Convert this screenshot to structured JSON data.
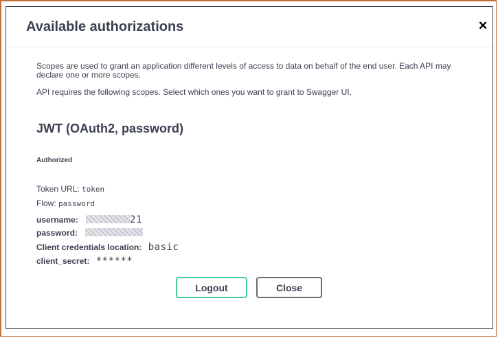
{
  "modal": {
    "title": "Available authorizations",
    "close_icon": "close-icon",
    "close_glyph": "✕"
  },
  "description": {
    "line1": "Scopes are used to grant an application different levels of access to data on behalf of the end user. Each API may declare one or more scopes.",
    "line2": "API requires the following scopes. Select which ones you want to grant to Swagger UI."
  },
  "scheme": {
    "title": "JWT (OAuth2, password)",
    "status": "Authorized",
    "token_url_label": "Token URL:",
    "token_url_value": "token",
    "flow_label": "Flow:",
    "flow_value": "password",
    "username_label": "username:",
    "username_suffix": "21",
    "password_label": "password:",
    "cred_location_label": "Client credentials location:",
    "cred_location_value": "basic",
    "client_secret_label": "client_secret:",
    "client_secret_value": "******"
  },
  "buttons": {
    "logout": "Logout",
    "close": "Close"
  },
  "colors": {
    "logout_border": "#49cc90",
    "frame_accent": "#c0703a",
    "text": "#3b4151"
  }
}
